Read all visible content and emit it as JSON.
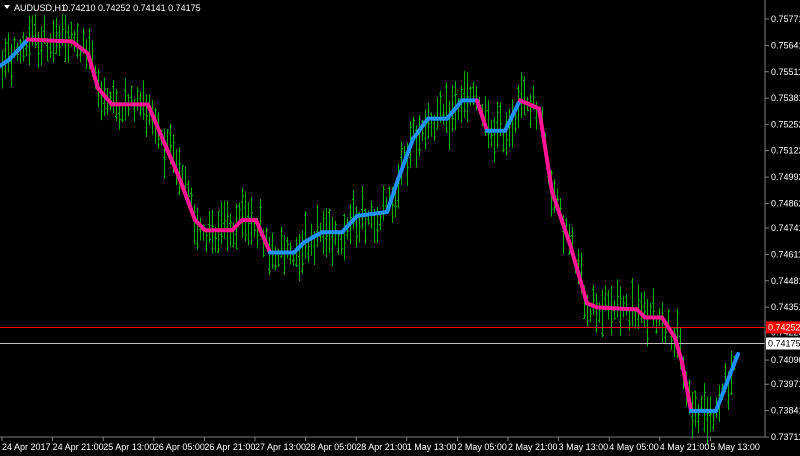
{
  "header": {
    "symbol": "AUDUSD,H1",
    "values": "0.74210 0.74252 0.74141 0.74175",
    "menu_icon": "triangle-down-icon"
  },
  "chart_data": {
    "type": "bar",
    "symbol": "AUDUSD",
    "timeframe": "H1",
    "ohlc_last": {
      "open": 0.7421,
      "high": 0.74252,
      "low": 0.74141,
      "close": 0.74175
    },
    "ylim": [
      0.737,
      0.758
    ],
    "y_ticks": [
      "0.75771",
      "0.75641",
      "0.75511",
      "0.75381",
      "0.75252",
      "0.75122",
      "0.74992",
      "0.74862",
      "0.74741",
      "0.74611",
      "0.74481",
      "0.74351",
      "0.74226",
      "0.74175",
      "0.74090",
      "0.73971",
      "0.73841",
      "0.73711"
    ],
    "x_ticks": [
      "24 Apr 2017",
      "24 Apr 21:00",
      "25 Apr 13:00",
      "26 Apr 05:00",
      "26 Apr 21:00",
      "27 Apr 13:00",
      "28 Apr 05:00",
      "28 Apr 21:00",
      "1 May 13:00",
      "2 May 05:00",
      "2 May 21:00",
      "3 May 13:00",
      "4 May 05:00",
      "4 May 21:00",
      "5 May 13:00"
    ],
    "price_lines": [
      {
        "name": "ask",
        "value": 0.74252,
        "label": "0.74252",
        "color": "#ff0000"
      },
      {
        "name": "bid",
        "value": 0.74175,
        "label": "0.74175",
        "color": "#c0c0c0"
      }
    ],
    "bar_color": "#00b000",
    "indicator": {
      "up_color": "#1e90ff",
      "down_color": "#ff1493",
      "points": [
        [
          0,
          0.7554,
          "up"
        ],
        [
          9,
          0.7557,
          "up"
        ],
        [
          28,
          0.7567,
          "down"
        ],
        [
          72,
          0.7566,
          "down"
        ],
        [
          88,
          0.756,
          "down"
        ],
        [
          98,
          0.7543,
          "down"
        ],
        [
          112,
          0.7535,
          "down"
        ],
        [
          148,
          0.7535,
          "down"
        ],
        [
          160,
          0.7521,
          "down"
        ],
        [
          180,
          0.7498,
          "down"
        ],
        [
          195,
          0.7478,
          "down"
        ],
        [
          205,
          0.7473,
          "down"
        ],
        [
          232,
          0.7473,
          "down"
        ],
        [
          242,
          0.7478,
          "down"
        ],
        [
          256,
          0.7478,
          "down"
        ],
        [
          270,
          0.7462,
          "up"
        ],
        [
          294,
          0.7462,
          "up"
        ],
        [
          304,
          0.7467,
          "up"
        ],
        [
          322,
          0.7472,
          "up"
        ],
        [
          337,
          0.7472,
          "up"
        ],
        [
          342,
          0.7472,
          "up"
        ],
        [
          357,
          0.748,
          "up"
        ],
        [
          387,
          0.7482,
          "up"
        ],
        [
          398,
          0.7498,
          "up"
        ],
        [
          413,
          0.7518,
          "up"
        ],
        [
          428,
          0.7528,
          "up"
        ],
        [
          447,
          0.7528,
          "up"
        ],
        [
          462,
          0.7537,
          "up"
        ],
        [
          477,
          0.7537,
          "down"
        ],
        [
          487,
          0.7522,
          "up"
        ],
        [
          505,
          0.7522,
          "up"
        ],
        [
          520,
          0.7537,
          "down"
        ],
        [
          539,
          0.7533,
          "down"
        ],
        [
          552,
          0.7492,
          "down"
        ],
        [
          570,
          0.7466,
          "down"
        ],
        [
          587,
          0.7437,
          "down"
        ],
        [
          597,
          0.7435,
          "down"
        ],
        [
          637,
          0.7434,
          "down"
        ],
        [
          645,
          0.743,
          "down"
        ],
        [
          662,
          0.743,
          "down"
        ],
        [
          675,
          0.742,
          "down"
        ],
        [
          682,
          0.7408,
          "down"
        ],
        [
          691,
          0.7384,
          "up"
        ],
        [
          716,
          0.7384,
          "up"
        ],
        [
          738,
          0.7412,
          "up"
        ]
      ]
    }
  }
}
